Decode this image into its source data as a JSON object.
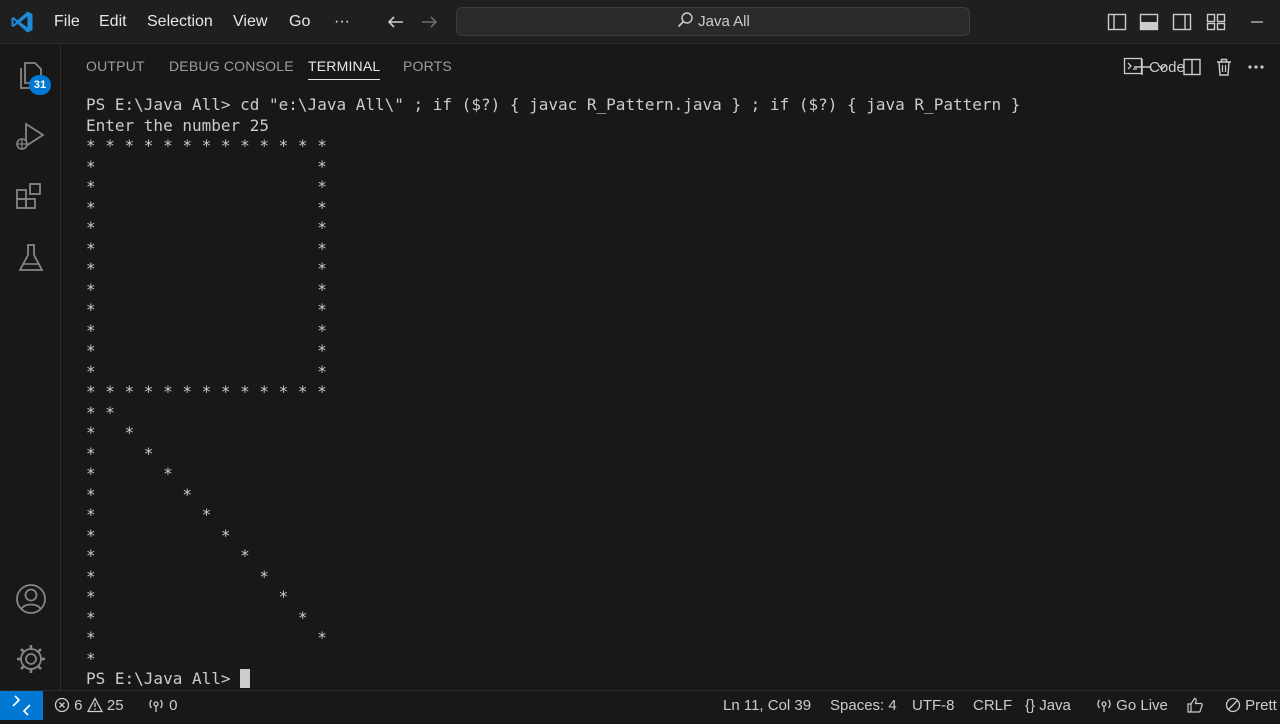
{
  "titlebar": {
    "menu": [
      "File",
      "Edit",
      "Selection",
      "View",
      "Go",
      "···"
    ],
    "search_text": "Java All"
  },
  "activitybar": {
    "items": [
      "explorer",
      "run-debug",
      "extensions",
      "testing"
    ],
    "explorer_badge": "31"
  },
  "panel": {
    "tabs": [
      "OUTPUT",
      "DEBUG CONSOLE",
      "TERMINAL",
      "PORTS"
    ],
    "active_tab": "TERMINAL",
    "terminal_profile": "Code"
  },
  "terminal": {
    "lines": [
      "PS E:\\Java All> cd \"e:\\Java All\\\" ; if ($?) { javac R_Pattern.java } ; if ($?) { java R_Pattern }",
      "Enter the number 25",
      "* * * * * * * * * * * * *",
      "*                       *",
      "*                       *",
      "*                       *",
      "*                       *",
      "*                       *",
      "*                       *",
      "*                       *",
      "*                       *",
      "*                       *",
      "*                       *",
      "*                       *",
      "* * * * * * * * * * * * *",
      "* *",
      "*   *",
      "*     *",
      "*       *",
      "*         *",
      "*           *",
      "*             *",
      "*               *",
      "*                 *",
      "*                   *",
      "*                     *",
      "*                       *",
      "*"
    ],
    "prompt": "PS E:\\Java All> "
  },
  "statusbar": {
    "errors": "6",
    "warnings": "25",
    "ports": "0",
    "position": "Ln 11, Col 39",
    "spaces": "Spaces: 4",
    "encoding": "UTF-8",
    "eol": "CRLF",
    "language": "Java",
    "go_live": "Go Live",
    "prettier": "Prett"
  },
  "colors": {
    "accent": "#0078d4",
    "background": "#181818",
    "text": "#cccccc"
  }
}
